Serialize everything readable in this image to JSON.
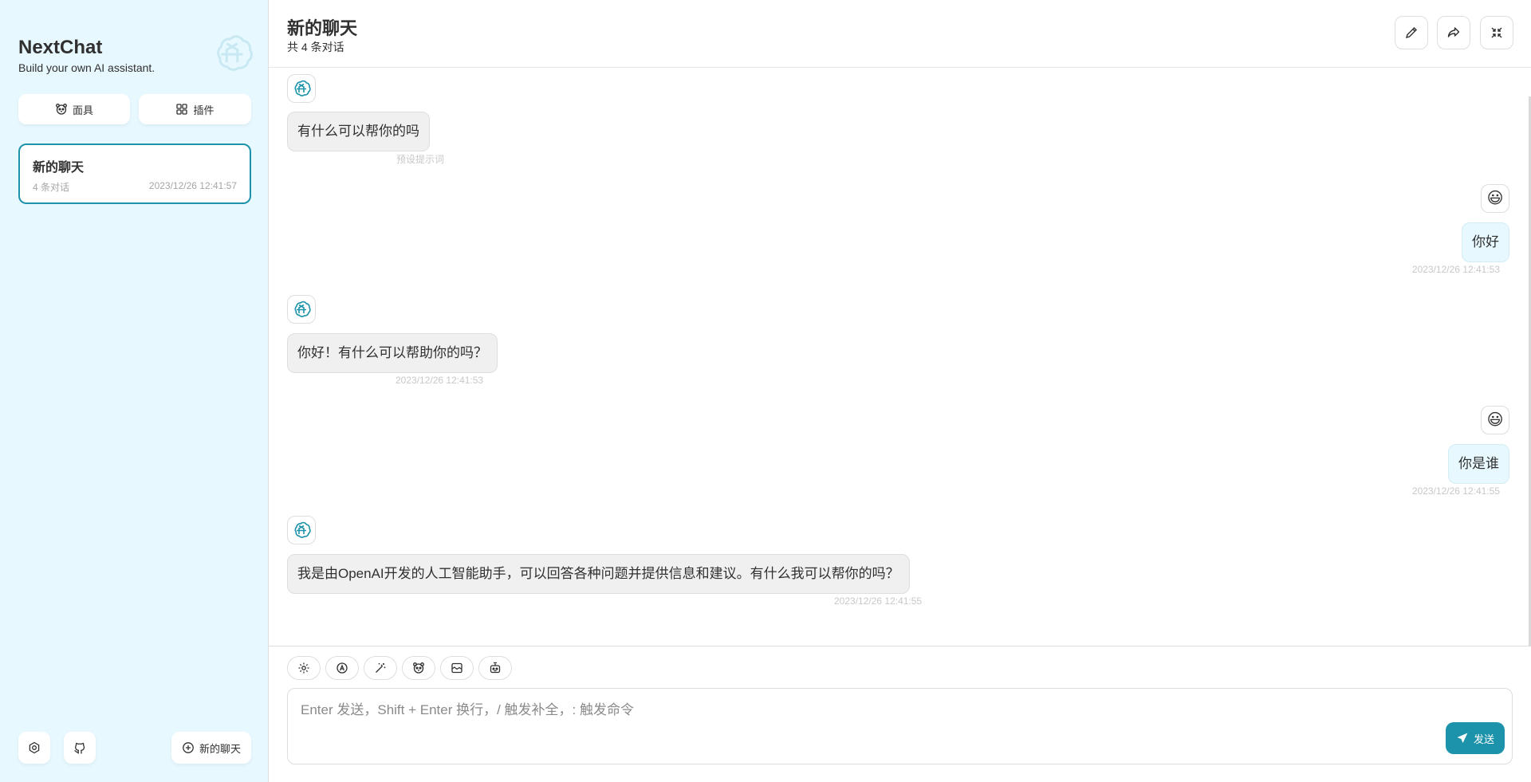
{
  "sidebar": {
    "brand_title": "NextChat",
    "brand_subtitle": "Build your own AI assistant.",
    "masks_label": "面具",
    "plugins_label": "插件",
    "chats": [
      {
        "title": "新的聊天",
        "count": "4 条对话",
        "date": "2023/12/26 12:41:57"
      }
    ],
    "new_chat_label": "新的聊天"
  },
  "header": {
    "title": "新的聊天",
    "subtitle": "共 4 条对话"
  },
  "messages": [
    {
      "role": "bot",
      "text": "有什么可以帮你的吗",
      "meta": "预设提示词"
    },
    {
      "role": "user",
      "avatar": "😃",
      "text": "你好",
      "meta": "2023/12/26 12:41:53"
    },
    {
      "role": "bot",
      "text": "你好！有什么可以帮助你的吗？",
      "meta": "2023/12/26 12:41:53"
    },
    {
      "role": "user",
      "avatar": "😃",
      "text": "你是谁",
      "meta": "2023/12/26 12:41:55"
    },
    {
      "role": "bot",
      "text": "我是由OpenAI开发的人工智能助手，可以回答各种问题并提供信息和建议。有什么我可以帮你的吗？",
      "meta": "2023/12/26 12:41:55"
    }
  ],
  "input": {
    "placeholder": "Enter 发送，Shift + Enter 换行，/ 触发补全，: 触发命令",
    "value": "",
    "send_label": "发送"
  },
  "colors": {
    "accent": "#1d93ab",
    "sidebar_bg": "#e7f8ff",
    "bot_bubble": "#f0f0f0",
    "user_bubble": "#e7f8ff"
  }
}
